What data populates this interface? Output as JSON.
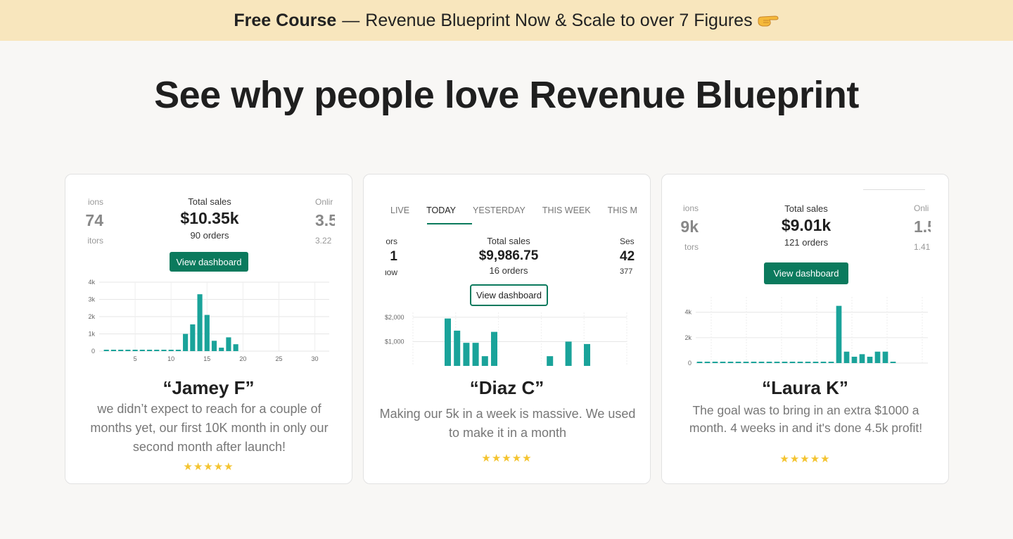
{
  "banner": {
    "bold": "Free Course",
    "dash": "—",
    "text": "Revenue Blueprint Now & Scale to over 7 Figures"
  },
  "headline": "See why people love Revenue Blueprint",
  "colors": {
    "accent": "#0b7a5d",
    "bar": "#1aa39a",
    "star": "#f4c430",
    "banner": "#f8e6bd"
  },
  "cards": [
    {
      "left_label": "ions",
      "left_value": "74",
      "left_sub": "itors",
      "total_label": "Total sales",
      "total_value": "$10.35k",
      "total_sub": "90 orders",
      "right_label": "Onlir",
      "right_value": "3.5",
      "right_sub": "3.22",
      "button": "View dashboard",
      "name": "“Jamey F”",
      "quote": "we didn’t expect to reach for a couple of months yet, our first 10K month in only our second month after launch!",
      "stars": "★★★★★"
    },
    {
      "tabs": [
        "LIVE",
        "TODAY",
        "YESTERDAY",
        "THIS WEEK",
        "THIS M"
      ],
      "left_label": "ors",
      "left_value": "1",
      "left_sub": "ιow",
      "total_label": "Total sales",
      "total_value": "$9,986.75",
      "total_sub": "16 orders",
      "right_label": "Ses",
      "right_value": "42",
      "right_sub": "377",
      "button": "View dashboard",
      "name": "“Diaz C”",
      "quote": "Making our 5k in a week is massive. We used to make it in a month",
      "stars": "★★★★★"
    },
    {
      "left_label": "ions",
      "left_value": "9k",
      "left_sub": "tors",
      "total_label": "Total sales",
      "total_value": "$9.01k",
      "total_sub": "121 orders",
      "right_label": "Onli",
      "right_value": "1.5",
      "right_sub": "1.41",
      "button": "View dashboard",
      "name": "“Laura K”",
      "quote": "The goal was to bring in an extra $1000 a month. 4 weeks in and it's done 4.5k profit!",
      "stars": "★★★★★"
    }
  ],
  "chart_data": [
    {
      "type": "bar",
      "x": [
        1,
        2,
        3,
        4,
        5,
        6,
        7,
        8,
        9,
        10,
        11,
        12,
        13,
        14,
        15,
        16,
        17,
        18,
        19
      ],
      "values": [
        0,
        0,
        0,
        0,
        0,
        0,
        0,
        0,
        0,
        0,
        50,
        1000,
        1550,
        3300,
        2100,
        600,
        200,
        800,
        400
      ],
      "ylim": [
        0,
        4000
      ],
      "yticks": [
        "0",
        "1k",
        "2k",
        "3k",
        "4k"
      ],
      "xticks": [
        "5",
        "10",
        "15",
        "20",
        "25",
        "30"
      ],
      "xtick_values": [
        5,
        10,
        15,
        20,
        25,
        30
      ],
      "xlim": [
        0,
        32
      ]
    },
    {
      "type": "bar",
      "categories": [
        "1",
        "2",
        "3",
        "4",
        "5",
        "6",
        "7",
        "8",
        "9",
        "10",
        "11",
        "12",
        "13",
        "14",
        "15",
        "16"
      ],
      "values": [
        1950,
        1450,
        950,
        950,
        400,
        1400,
        0,
        0,
        0,
        0,
        0,
        400,
        0,
        1000,
        0,
        900
      ],
      "ylim": [
        0,
        2200
      ],
      "yticks": [
        "$1,000",
        "$2,000"
      ],
      "ytick_values": [
        1000,
        2000
      ]
    },
    {
      "type": "bar",
      "x": [
        1,
        2,
        3,
        4,
        5,
        6,
        7,
        8,
        9,
        10,
        11,
        12,
        13,
        14,
        15,
        16,
        17,
        18,
        19,
        20,
        21,
        22,
        23,
        24,
        25,
        26,
        27,
        28,
        29,
        30
      ],
      "values": [
        0,
        0,
        0,
        0,
        0,
        0,
        0,
        0,
        0,
        0,
        0,
        0,
        0,
        0,
        0,
        0,
        0,
        0,
        4500,
        900,
        500,
        700,
        500,
        900,
        900,
        0,
        0,
        0,
        0,
        0
      ],
      "ylim": [
        0,
        5200
      ],
      "yticks": [
        "0",
        "2k",
        "4k"
      ],
      "ytick_values": [
        0,
        2000,
        4000
      ]
    }
  ]
}
